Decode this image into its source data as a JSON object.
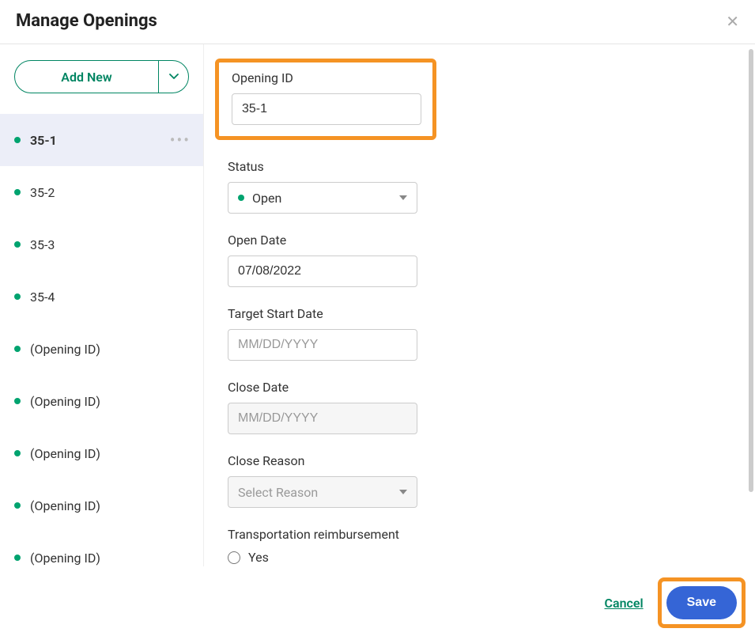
{
  "header": {
    "title": "Manage Openings"
  },
  "sidebar": {
    "add_new_label": "Add New",
    "items": [
      {
        "label": "35-1",
        "selected": true
      },
      {
        "label": "35-2",
        "selected": false
      },
      {
        "label": "35-3",
        "selected": false
      },
      {
        "label": "35-4",
        "selected": false
      },
      {
        "label": "(Opening ID)",
        "selected": false
      },
      {
        "label": "(Opening ID)",
        "selected": false
      },
      {
        "label": "(Opening ID)",
        "selected": false
      },
      {
        "label": "(Opening ID)",
        "selected": false
      },
      {
        "label": "(Opening ID)",
        "selected": false
      }
    ]
  },
  "form": {
    "opening_id": {
      "label": "Opening ID",
      "value": "35-1"
    },
    "status": {
      "label": "Status",
      "value": "Open"
    },
    "open_date": {
      "label": "Open Date",
      "value": "07/08/2022"
    },
    "target_start": {
      "label": "Target Start Date",
      "placeholder": "MM/DD/YYYY",
      "value": ""
    },
    "close_date": {
      "label": "Close Date",
      "placeholder": "MM/DD/YYYY",
      "value": ""
    },
    "close_reason": {
      "label": "Close Reason",
      "placeholder": "Select Reason"
    },
    "transport": {
      "label": "Transportation reimbursement",
      "option_yes": "Yes"
    }
  },
  "footer": {
    "cancel": "Cancel",
    "save": "Save"
  }
}
